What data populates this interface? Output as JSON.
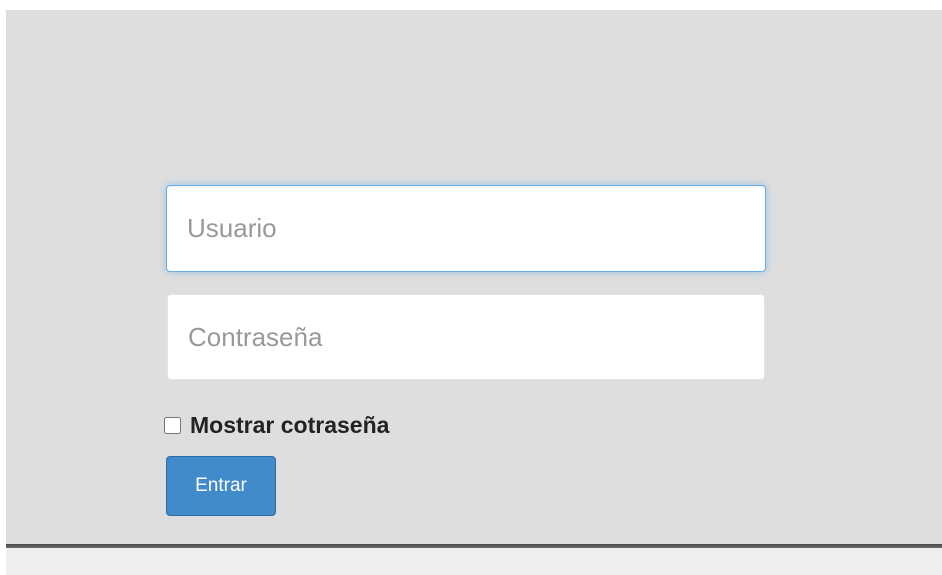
{
  "login": {
    "username": {
      "value": "",
      "placeholder": "Usuario"
    },
    "password": {
      "value": "",
      "placeholder": "Contraseña"
    },
    "show_password": {
      "label": "Mostrar cotraseña",
      "checked": false
    },
    "submit": {
      "label": "Entrar",
      "color": "#428bca"
    }
  },
  "colors": {
    "panel_background": "#dedede",
    "focus_border": "#66afe9"
  }
}
